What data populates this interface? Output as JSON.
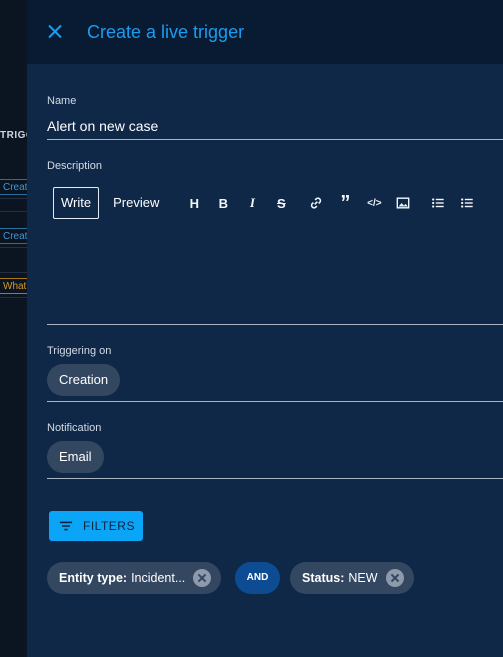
{
  "background": {
    "column_header": "TRIGGERING ON",
    "rows": [
      {
        "label": "Creation",
        "color": "blue"
      },
      {
        "label": "Creation",
        "color": "blue"
      },
      {
        "label": "",
        "color": "none"
      },
      {
        "label": "What act",
        "color": "orange"
      },
      {
        "label": "",
        "color": "none"
      }
    ]
  },
  "drawer": {
    "title": "Create a live trigger",
    "close_icon": "close-icon"
  },
  "form": {
    "name": {
      "label": "Name",
      "value": "Alert on new case"
    },
    "description": {
      "label": "Description",
      "tabs": [
        {
          "label": "Write",
          "active": true
        },
        {
          "label": "Preview",
          "active": false
        }
      ],
      "toolbar_icons": [
        "heading-icon",
        "bold-icon",
        "italic-icon",
        "strikethrough-icon",
        "link-icon",
        "quote-icon",
        "code-icon",
        "image-icon",
        "bulleted-list-icon",
        "numbered-list-icon"
      ],
      "value": ""
    },
    "triggering_on": {
      "label": "Triggering on",
      "value": "Creation"
    },
    "notification": {
      "label": "Notification",
      "value": "Email"
    }
  },
  "filters": {
    "button_label": "FILTERS",
    "chips": [
      {
        "key": "Entity type:",
        "value": "Incident..."
      },
      {
        "key": "Status:",
        "value": "NEW"
      }
    ],
    "operator": "AND"
  },
  "colors": {
    "accent": "#1a9df1",
    "drawer_bg": "#0f2847",
    "header_bg": "#081b33",
    "pill_bg": "#344761",
    "filters_button": "#0aa5f7",
    "operator_bg": "#0d4b92"
  }
}
